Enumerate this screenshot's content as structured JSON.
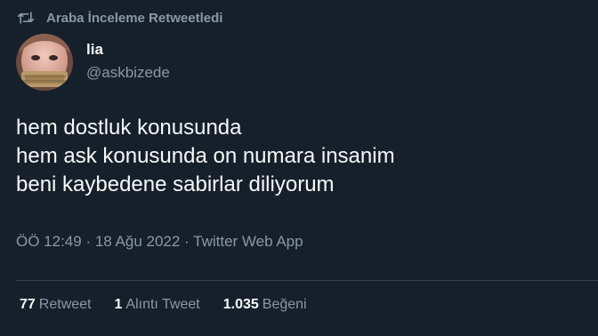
{
  "retweet": {
    "label": "Araba İnceleme Retweetledi",
    "icon": "retweet-icon"
  },
  "author": {
    "name": "lia",
    "handle": "@askbizede",
    "avatar": "avatar-photo"
  },
  "tweet": {
    "lines": [
      "hem dostluk konusunda",
      "hem ask konusunda on numara insanim",
      "beni kaybedene sabirlar diliyorum"
    ]
  },
  "meta": {
    "time": "ÖÖ 12:49",
    "separator1": " · ",
    "date": "18 Ağu 2022",
    "separator2": " · ",
    "source": "Twitter Web App"
  },
  "stats": {
    "retweets": {
      "count": "77",
      "label": "Retweet"
    },
    "quotes": {
      "count": "1",
      "label": "Alıntı Tweet"
    },
    "likes": {
      "count": "1.035",
      "label": "Beğeni"
    }
  },
  "colors": {
    "background": "#15202b",
    "text": "#f7f9f9",
    "secondary": "#8b98a5",
    "divider": "#38444d"
  }
}
